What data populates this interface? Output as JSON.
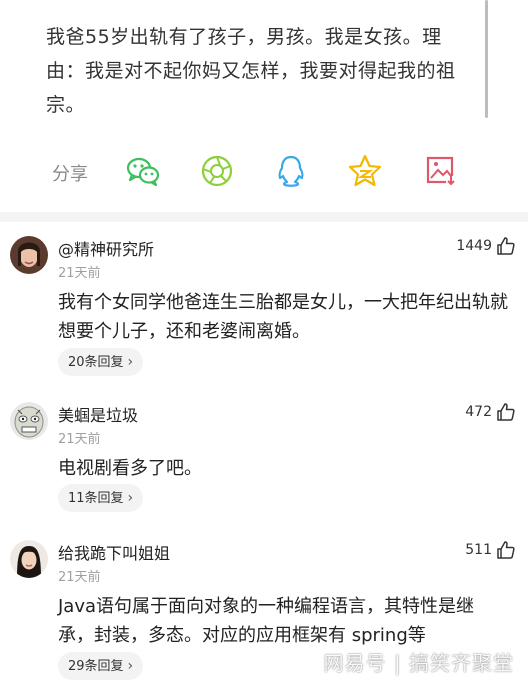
{
  "post": {
    "text": "我爸55岁出轨有了孩子，男孩。我是女孩。理由：我是对不起你妈又怎样，我要对得起我的祖宗。"
  },
  "share": {
    "label": "分享",
    "icons": [
      "wechat-icon",
      "moments-icon",
      "qq-icon",
      "qzone-icon",
      "save-image-icon"
    ],
    "colors": {
      "wechat": "#3cbf5c",
      "moments": "#8bcf3a",
      "qq": "#39a7e8",
      "qzone": "#f5b700",
      "save": "#e0566a"
    }
  },
  "comments": [
    {
      "name": "@精神研究所",
      "time": "21天前",
      "likes": "1449",
      "text": "我有个女同学他爸连生三胎都是女儿，一大把年纪出轨就想要个儿子，还和老婆闹离婚。",
      "replies": "20条回复"
    },
    {
      "name": "美蝈是垃圾",
      "time": "21天前",
      "likes": "472",
      "text": "电视剧看多了吧。",
      "replies": "11条回复"
    },
    {
      "name": "给我跪下叫姐姐",
      "time": "21天前",
      "likes": "511",
      "text": "Java语句属于面向对象的一种编程语言，其特性是继承，封装，多态。对应的应用框架有 spring等",
      "replies": "29条回复"
    }
  ],
  "watermark": "网易号 | 搞笑齐聚堂"
}
